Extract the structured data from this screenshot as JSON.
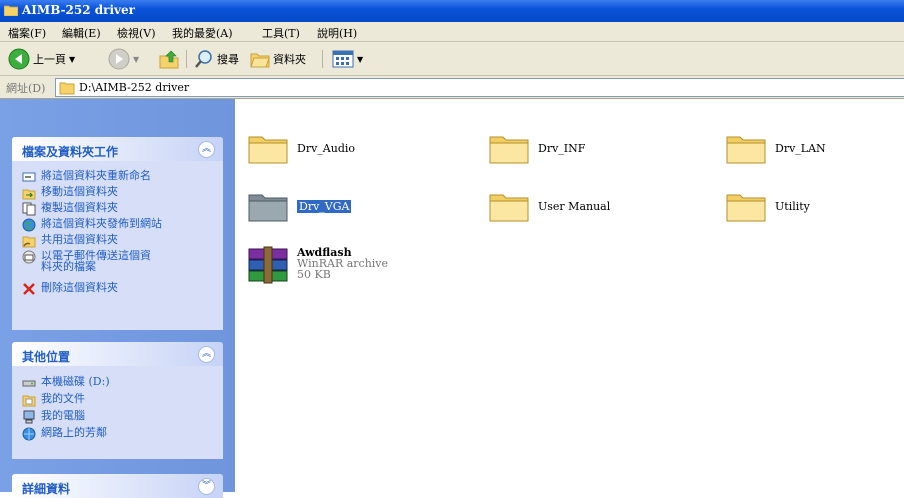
{
  "window": {
    "title": "AIMB-252 driver"
  },
  "menu": [
    "檔案(F)",
    "編輯(E)",
    "檢視(V)",
    "我的最愛(A)",
    "工具(T)",
    "說明(H)"
  ],
  "toolbar": {
    "back_label": "上一頁",
    "search_label": "搜尋",
    "folders_label": "資料夾"
  },
  "address": {
    "label": "網址(D)",
    "value": "D:\\AIMB-252 driver"
  },
  "tasks_panel": {
    "title": "檔案及資料夾工作",
    "items": [
      {
        "label": "將這個資料夾重新命名",
        "icon": "rename-icon"
      },
      {
        "label": "移動這個資料夾",
        "icon": "move-icon"
      },
      {
        "label": "複製這個資料夾",
        "icon": "copy-icon"
      },
      {
        "label": "將這個資料夾發佈到網站",
        "icon": "publish-icon"
      },
      {
        "label": "共用這個資料夾",
        "icon": "share-icon"
      },
      {
        "label": "以電子郵件傳送這個資料夾的檔案",
        "icon": "email-icon"
      },
      {
        "label": "刪除這個資料夾",
        "icon": "delete-icon"
      }
    ]
  },
  "places_panel": {
    "title": "其他位置",
    "items": [
      {
        "label": "本機磁碟 (D:)",
        "icon": "drive-icon"
      },
      {
        "label": "我的文件",
        "icon": "my-documents-icon"
      },
      {
        "label": "我的電腦",
        "icon": "my-computer-icon"
      },
      {
        "label": "網路上的芳鄰",
        "icon": "network-icon"
      }
    ]
  },
  "details_panel": {
    "title": "詳細資料"
  },
  "files": [
    {
      "name": "Drv_Audio",
      "type": "folder"
    },
    {
      "name": "Drv_INF",
      "type": "folder"
    },
    {
      "name": "Drv_LAN",
      "type": "folder"
    },
    {
      "name": "Drv_VGA",
      "type": "folder",
      "selected": true
    },
    {
      "name": "User Manual",
      "type": "folder"
    },
    {
      "name": "Utility",
      "type": "folder"
    },
    {
      "name": "Awdflash",
      "type": "archive",
      "subtype": "WinRAR archive",
      "size": "50 KB"
    }
  ],
  "colors": {
    "title_bar": "#0a53d9",
    "panel_link": "#215dc6",
    "selection": "#316ac5",
    "left_pane": "#7aa1e6"
  }
}
